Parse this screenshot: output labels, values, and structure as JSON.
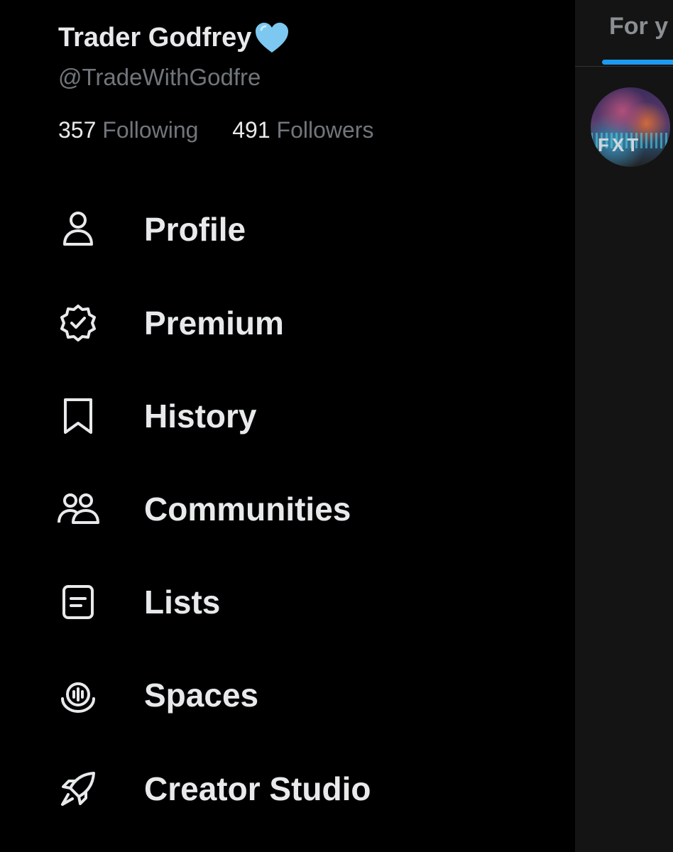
{
  "profile": {
    "name": "Trader Godfrey",
    "handle": "@TradeWithGodfre",
    "following_count": "357",
    "following_label": "Following",
    "followers_count": "491",
    "followers_label": "Followers",
    "badge_icon": "blue-heart-icon",
    "badge_color": "#7dc8f0"
  },
  "menu": {
    "items": [
      {
        "label": "Profile",
        "icon": "person-icon"
      },
      {
        "label": "Premium",
        "icon": "verified-badge-icon"
      },
      {
        "label": "History",
        "icon": "bookmark-icon"
      },
      {
        "label": "Communities",
        "icon": "communities-icon"
      },
      {
        "label": "Lists",
        "icon": "list-icon"
      },
      {
        "label": "Spaces",
        "icon": "spaces-icon"
      },
      {
        "label": "Creator Studio",
        "icon": "rocket-icon"
      }
    ]
  },
  "feed": {
    "tab_label": "For y",
    "avatar_text": "FXT",
    "accent_color": "#1d9bf0"
  }
}
